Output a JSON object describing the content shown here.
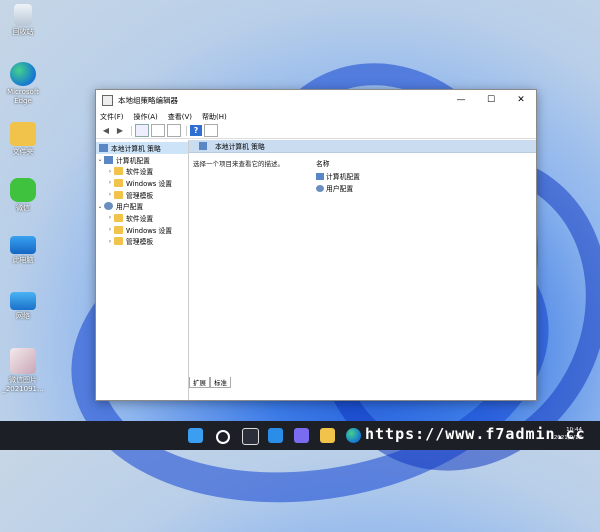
{
  "desktop": {
    "icons": [
      {
        "label": "回收站",
        "icon": "recycle-bin-icon"
      },
      {
        "label": "Microsoft Edge",
        "icon": "edge-icon"
      },
      {
        "label": "文件夹",
        "icon": "folder-icon"
      },
      {
        "label": "微信",
        "icon": "wechat-icon"
      },
      {
        "label": "此电脑",
        "icon": "computer-icon"
      },
      {
        "label": "网络",
        "icon": "network-icon"
      },
      {
        "label": "微信图片_2021091...",
        "icon": "image-file-icon"
      }
    ]
  },
  "window": {
    "title": "本地组策略编辑器",
    "controls": {
      "minimize": "—",
      "maximize": "☐",
      "close": "✕"
    },
    "menu": [
      "文件(F)",
      "操作(A)",
      "查看(V)",
      "帮助(H)"
    ],
    "tree": {
      "root": "本地计算机 策略",
      "computer_config": "计算机配置",
      "computer_children": [
        "软件设置",
        "Windows 设置",
        "管理模板"
      ],
      "user_config": "用户配置",
      "user_children": [
        "软件设置",
        "Windows 设置",
        "管理模板"
      ]
    },
    "right": {
      "header": "本地计算机 策略",
      "description": "选择一个项目来查看它的描述。",
      "column_name": "名称",
      "items": [
        "计算机配置",
        "用户配置"
      ]
    },
    "tabs": [
      "扩展",
      "标准"
    ]
  },
  "taskbar": {
    "icons": [
      "start-icon",
      "search-icon",
      "task-view-icon",
      "widgets-icon",
      "chat-icon",
      "file-explorer-icon",
      "edge-icon",
      "store-icon"
    ],
    "time": "10:44",
    "date": "2021/9/18"
  },
  "watermark": "https://www.f7admin.cc",
  "colors": {
    "accent": "#1f57d8",
    "selection": "#cde3f7",
    "taskbar": "#1c1f26",
    "folder": "#f2c34a"
  }
}
